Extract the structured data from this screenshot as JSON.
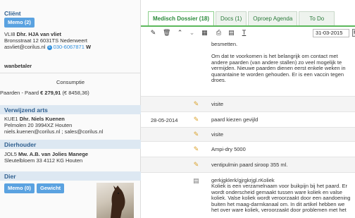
{
  "client": {
    "header": "Cliënt",
    "memo_label": "Memo (2)",
    "name_code": "VLI8",
    "name": "Dhr. HJA van vliet",
    "address": "Bronsstraat 12 6031TS Nederweert",
    "email": "asvliet@corilus.nl",
    "phone": "030-6067871",
    "phone_suffix": "W",
    "status": "wanbetaler",
    "consumption_label": "Consumptie",
    "consumption_prefix": "Paarden  - Paard",
    "consumption_amount": "€ 279,91",
    "consumption_total": "(€ 8458,36)"
  },
  "referring_vet": {
    "header": "Verwijzend arts",
    "code": "KUE1",
    "name": "Dhr. Niels Kuenen",
    "address": "Pelmolen 20 3994XZ Houten",
    "emails": "niels.kuenen@corilus.nl ; sales@corilus.nl"
  },
  "holder": {
    "header": "Dierhouder",
    "code": "JOL5",
    "name": "Mw. A.B. van Jolies Manege",
    "address": "Sleutelbloem 33 4112 KG Houten"
  },
  "animal": {
    "header": "Dier",
    "memo_label": "Memo (0)",
    "weight_label": "Gewicht"
  },
  "tabs": [
    {
      "label": "Medisch Dossier (18)",
      "active": true
    },
    {
      "label": "Docs (1)",
      "active": false
    },
    {
      "label": "Oproep Agenda",
      "active": false
    },
    {
      "label": "To Do",
      "active": false
    }
  ],
  "toolbar": {
    "date": "31-03-2015",
    "icons": [
      "pencil-icon",
      "trash-icon",
      "chevron-up-icon",
      "chevron-down-icon",
      "calendar-icon",
      "print-icon",
      "document-icon",
      "text-format-icon"
    ]
  },
  "entries": [
    {
      "date": "",
      "icon": "document-icon",
      "text_top": "besmetten.",
      "text_body": "Om dat te voorkomen is het belangrijk om contact met andere paarden (van andere stallen) zo veel mogelijk te vermijden. Nieuwe paarden dienen eerst enkele weken in quarantaine te worden gehouden. Er is een vaccin tegen droes."
    },
    {
      "date": "",
      "icon": "pencil-icon",
      "text": "visite"
    },
    {
      "date": "28-05-2014",
      "icon": "pencil-icon",
      "text": "paard kiezen gevijld"
    },
    {
      "date": "",
      "icon": "pencil-icon",
      "text": "visite"
    },
    {
      "date": "",
      "icon": "pencil-icon",
      "text": "Ampi-dry 5000"
    },
    {
      "date": "",
      "icon": "pencil-icon",
      "text": "ventipulmin paard siroop 355 ml."
    },
    {
      "date": "",
      "icon": "document-icon",
      "text_top": "gerkjgklerk/gjrgkrjgl.rKoliek",
      "text_body": "Koliek is een verzamelnaam voor buikpijn bij het paard. Er wordt onderscheid gemaakt tussen ware koliek en valse koliek. Valse koliek wordt veroorzaakt door een aandoening buiten het maag-darmkanaal om. In dit artikel hebben we het over ware koliek, veroorzaakt door problemen met het"
    }
  ]
}
